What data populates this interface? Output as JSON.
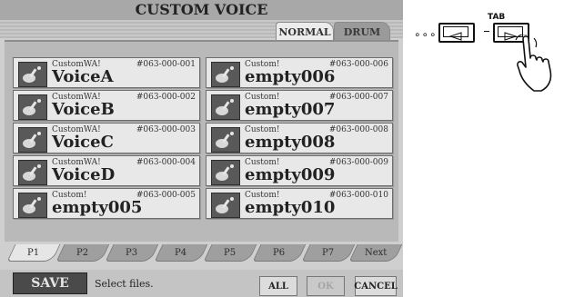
{
  "window": {
    "title": "CUSTOM VOICE"
  },
  "tabs": [
    {
      "label": "NORMAL",
      "active": true
    },
    {
      "label": "DRUM",
      "active": false
    }
  ],
  "slots": [
    {
      "category": "CustomWA!",
      "number": "#063-000-001",
      "name": "VoiceA"
    },
    {
      "category": "CustomWA!",
      "number": "#063-000-002",
      "name": "VoiceB"
    },
    {
      "category": "CustomWA!",
      "number": "#063-000-003",
      "name": "VoiceC"
    },
    {
      "category": "CustomWA!",
      "number": "#063-000-004",
      "name": "VoiceD"
    },
    {
      "category": "Custom!",
      "number": "#063-000-005",
      "name": "empty005"
    },
    {
      "category": "Custom!",
      "number": "#063-000-006",
      "name": "empty006"
    },
    {
      "category": "Custom!",
      "number": "#063-000-007",
      "name": "empty007"
    },
    {
      "category": "Custom!",
      "number": "#063-000-008",
      "name": "empty008"
    },
    {
      "category": "Custom!",
      "number": "#063-000-009",
      "name": "empty009"
    },
    {
      "category": "Custom!",
      "number": "#063-000-010",
      "name": "empty010"
    }
  ],
  "pages": [
    "P1",
    "P2",
    "P3",
    "P4",
    "P5",
    "P6",
    "P7",
    "Next"
  ],
  "footer": {
    "save_label": "SAVE",
    "message": "Select files.",
    "all_label": "ALL",
    "ok_label": "OK",
    "cancel_label": "CANCEL"
  },
  "side_panel": {
    "tab_label": "TAB",
    "dots": "∘∘∘"
  },
  "icons": {
    "voice": "guitar-icon",
    "left_button": "left-arrow-icon",
    "right_button": "right-arrow-icon",
    "pointer": "pointing-hand-icon"
  }
}
